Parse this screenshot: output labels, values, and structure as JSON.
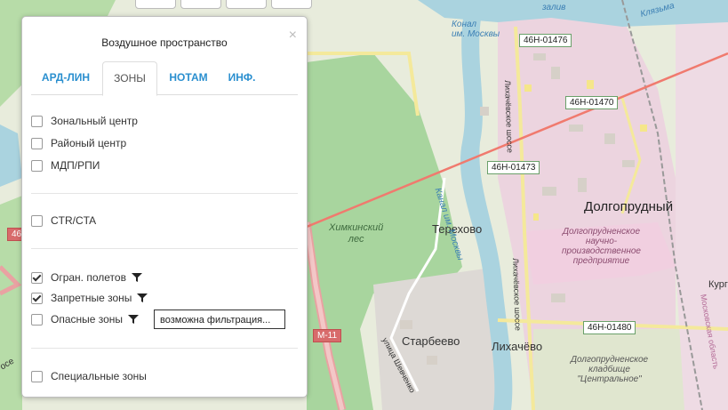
{
  "panel": {
    "title": "Воздушное пространство",
    "close": "×",
    "tabs": [
      "АРД-ЛИН",
      "ЗОНЫ",
      "НОТАМ",
      "ИНФ."
    ],
    "active_tab": "ЗОНЫ",
    "items": [
      {
        "label": "Зональный центр",
        "checked": false
      },
      {
        "label": "Районый центр",
        "checked": false
      },
      {
        "label": "МДП/РПИ",
        "checked": false
      },
      {
        "label": "CTR/CTA",
        "checked": false
      },
      {
        "label": "Огран. полетов",
        "checked": true,
        "filter": true
      },
      {
        "label": "Запретные зоны",
        "checked": true,
        "filter": true
      },
      {
        "label": "Опасные зоны",
        "checked": false,
        "filter": true
      },
      {
        "label": "Специальные зоны",
        "checked": false
      }
    ],
    "tooltip": "возможна фильтрация..."
  },
  "map": {
    "labels": {
      "dolgoprudny": "Долгопрудный",
      "terekhovo": "Терехово",
      "starbeevo": "Старбеево",
      "likhachevo": "Лихачёво",
      "forest1": "Химкинский",
      "forest2": "лес",
      "kanal1": "Конал",
      "kanal2": "им. Москвы",
      "zaliv": "залив",
      "klyazma": "Клязьма",
      "kanal_river": "Канал им. Москвы",
      "lich_shosse": "Лихачёвское шоссе",
      "lich_shosse2": "Лихачёвское шоссе",
      "ulitsa_shevchenko": "улица Шевченко",
      "moscow_obl": "Московская область",
      "kurg": "Кург",
      "ose": "осе",
      "poi1": [
        "Долгопрудненское",
        "научно-",
        "производственное",
        "предприятие"
      ],
      "poi2": [
        "Долгопрудненское",
        "кладбище",
        "\"Центральное\""
      ]
    },
    "shields": {
      "s1": "46Н-01476",
      "s2": "46Н-01470",
      "s3": "46Н-01473",
      "s4": "46Н-01480",
      "m11": "М-11",
      "s46": "46"
    }
  }
}
